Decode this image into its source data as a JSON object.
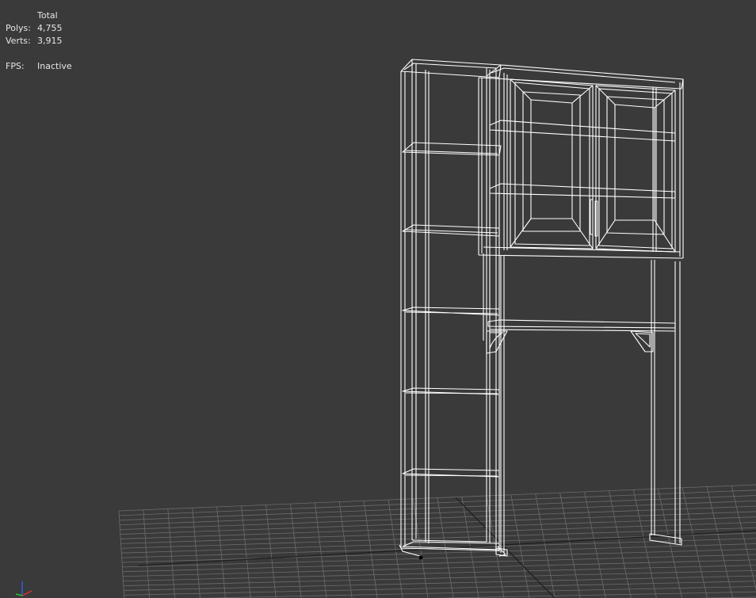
{
  "viewport": {
    "background": "#3a3a3a",
    "grid_color": "#6c6c6c",
    "wire_color": "#ffffff",
    "view_mode": "wireframe"
  },
  "statistics": {
    "header": "Total",
    "polys_label": "Polys:",
    "polys_value": "4,755",
    "verts_label": "Verts:",
    "verts_value": "3,915",
    "fps_label": "FPS:",
    "fps_value": "Inactive"
  },
  "axis_gizmo": {
    "icon": "xyz-axis-icon",
    "colors": {
      "x": "#e03030",
      "y": "#30c030",
      "z": "#3060e0"
    }
  },
  "model": {
    "icon": "shelving-unit-wireframe",
    "shelf_count": 6
  }
}
